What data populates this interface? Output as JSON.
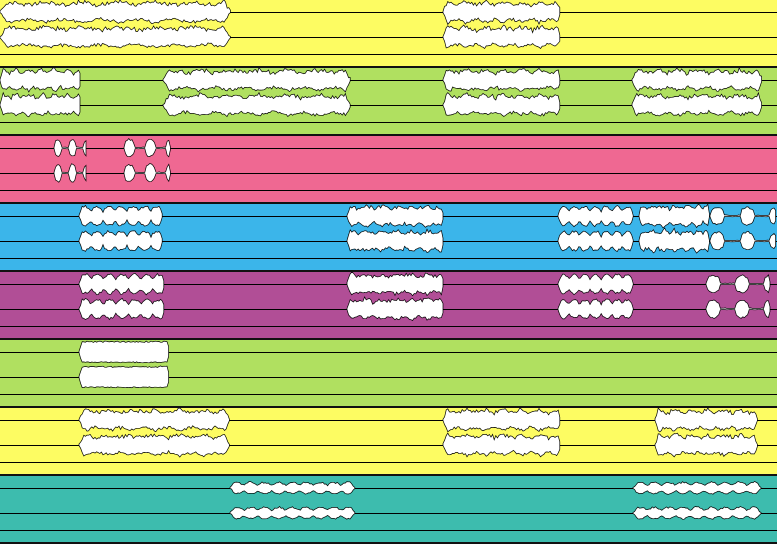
{
  "colors": {
    "yellow": "#fdfc62",
    "green": "#b0e060",
    "pink": "#ef6892",
    "blue": "#3bb5ea",
    "purple": "#b14e96",
    "teal": "#3dbcae",
    "waveform_fill": "#ffffff",
    "waveform_stroke": "#000000"
  },
  "tracks": [
    {
      "color": "yellow",
      "regions": [
        {
          "start": 0.0,
          "end": 0.297,
          "style": "dense",
          "seed": 1
        },
        {
          "start": 0.57,
          "end": 0.722,
          "style": "dense",
          "seed": 2
        }
      ]
    },
    {
      "color": "green",
      "regions": [
        {
          "start": 0.0,
          "end": 0.105,
          "style": "dense",
          "seed": 3
        },
        {
          "start": 0.21,
          "end": 0.452,
          "style": "dense",
          "seed": 4
        },
        {
          "start": 0.57,
          "end": 0.722,
          "style": "dense",
          "seed": 5
        },
        {
          "start": 0.813,
          "end": 0.981,
          "style": "dense",
          "seed": 6
        }
      ]
    },
    {
      "color": "pink",
      "regions": [
        {
          "start": 0.069,
          "end": 0.112,
          "style": "blobs",
          "seed": 7
        },
        {
          "start": 0.159,
          "end": 0.219,
          "style": "blobs",
          "seed": 8
        }
      ]
    },
    {
      "color": "blue",
      "regions": [
        {
          "start": 0.102,
          "end": 0.21,
          "style": "spiky",
          "seed": 9
        },
        {
          "start": 0.447,
          "end": 0.572,
          "style": "dense",
          "seed": 10
        },
        {
          "start": 0.718,
          "end": 0.815,
          "style": "spiky",
          "seed": 11
        },
        {
          "start": 0.823,
          "end": 0.914,
          "style": "dense",
          "seed": 12
        },
        {
          "start": 0.914,
          "end": 1.0,
          "style": "blobs",
          "seed": 13
        }
      ]
    },
    {
      "color": "purple",
      "regions": [
        {
          "start": 0.102,
          "end": 0.213,
          "style": "spiky",
          "seed": 14
        },
        {
          "start": 0.447,
          "end": 0.572,
          "style": "dense",
          "seed": 15
        },
        {
          "start": 0.718,
          "end": 0.815,
          "style": "spiky",
          "seed": 16
        },
        {
          "start": 0.909,
          "end": 0.992,
          "style": "blobs",
          "seed": 17
        }
      ]
    },
    {
      "color": "green",
      "regions": [
        {
          "start": 0.102,
          "end": 0.219,
          "style": "chunk",
          "seed": 18
        }
      ]
    },
    {
      "color": "yellow",
      "regions": [
        {
          "start": 0.102,
          "end": 0.296,
          "style": "dense",
          "seed": 19
        },
        {
          "start": 0.57,
          "end": 0.722,
          "style": "dense",
          "seed": 20
        },
        {
          "start": 0.843,
          "end": 0.975,
          "style": "dense",
          "seed": 21
        }
      ]
    },
    {
      "color": "teal",
      "regions": [
        {
          "start": 0.296,
          "end": 0.457,
          "style": "thin",
          "seed": 22
        },
        {
          "start": 0.815,
          "end": 0.98,
          "style": "thin",
          "seed": 23
        }
      ]
    }
  ]
}
